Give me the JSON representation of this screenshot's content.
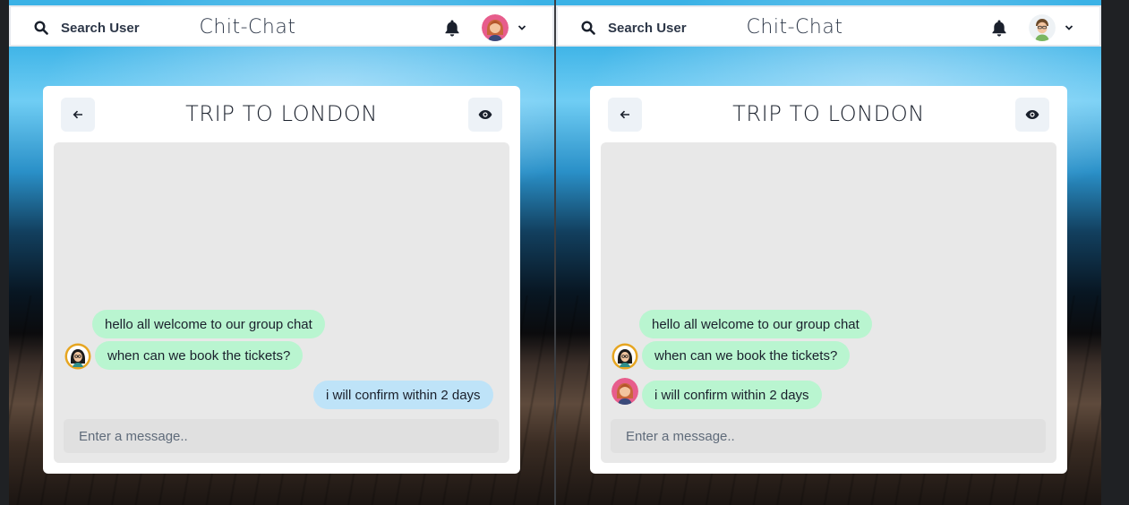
{
  "app": {
    "brand": "Chit-Chat",
    "search_label": "Search User"
  },
  "chat": {
    "title": "TRIP TO LONDON",
    "input_placeholder": "Enter a message..",
    "messages": [
      {
        "text": "hello all welcome to our group chat"
      },
      {
        "text": "when can we book the tickets?"
      },
      {
        "text": "i will confirm within 2 days"
      }
    ]
  },
  "colors": {
    "incoming_bubble": "#b9f5d0",
    "own_bubble": "#bee3f8",
    "chat_background": "#e8e8e8"
  },
  "icons": [
    "search-icon",
    "bell-icon",
    "chevron-down-icon",
    "arrow-left-icon",
    "eye-icon"
  ]
}
